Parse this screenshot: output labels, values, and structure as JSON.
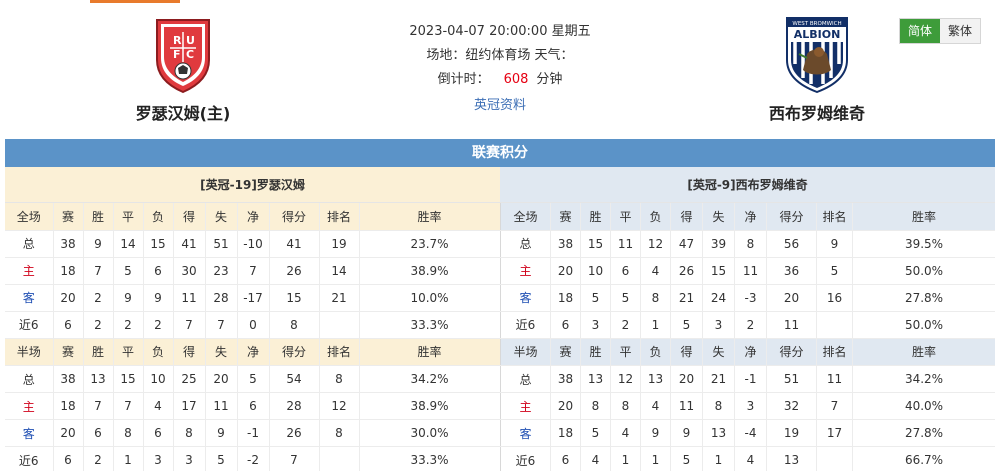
{
  "match": {
    "datetime": "2023-04-07 20:00:00 星期五",
    "venue": "场地：纽约体育场 天气：",
    "countdown_label": "倒计时：",
    "countdown_value": "608",
    "countdown_unit": "分钟",
    "league_link": "英冠资料"
  },
  "home_team": {
    "name": "罗瑟汉姆(主)",
    "logo": "rotherham-crest-icon"
  },
  "away_team": {
    "name": "西布罗姆维奇",
    "logo": "west-brom-albion-crest-icon"
  },
  "lang": {
    "simplified": "简体",
    "traditional": "繁体"
  },
  "section_title": "联赛积分",
  "colors": {
    "title_bar": "#5b93c8",
    "home_panel": "#fbf0d6",
    "away_panel": "#e0e8f1",
    "active_lang": "#3e9c3a",
    "home_label": "#d0021b",
    "away_label": "#1f4fb3",
    "countdown": "#e60012"
  },
  "left_panel": {
    "caption": "[英冠-19]罗瑟汉姆",
    "full": {
      "headers": [
        "全场",
        "赛",
        "胜",
        "平",
        "负",
        "得",
        "失",
        "净",
        "得分",
        "排名",
        "胜率"
      ],
      "rows": [
        [
          "总",
          "38",
          "9",
          "14",
          "15",
          "41",
          "51",
          "-10",
          "41",
          "19",
          "23.7%"
        ],
        [
          "主",
          "18",
          "7",
          "5",
          "6",
          "30",
          "23",
          "7",
          "26",
          "14",
          "38.9%"
        ],
        [
          "客",
          "20",
          "2",
          "9",
          "9",
          "11",
          "28",
          "-17",
          "15",
          "21",
          "10.0%"
        ],
        [
          "近6",
          "6",
          "2",
          "2",
          "2",
          "7",
          "7",
          "0",
          "8",
          "",
          "33.3%"
        ]
      ]
    },
    "half": {
      "headers": [
        "半场",
        "赛",
        "胜",
        "平",
        "负",
        "得",
        "失",
        "净",
        "得分",
        "排名",
        "胜率"
      ],
      "rows": [
        [
          "总",
          "38",
          "13",
          "15",
          "10",
          "25",
          "20",
          "5",
          "54",
          "8",
          "34.2%"
        ],
        [
          "主",
          "18",
          "7",
          "7",
          "4",
          "17",
          "11",
          "6",
          "28",
          "12",
          "38.9%"
        ],
        [
          "客",
          "20",
          "6",
          "8",
          "6",
          "8",
          "9",
          "-1",
          "26",
          "8",
          "30.0%"
        ],
        [
          "近6",
          "6",
          "2",
          "1",
          "3",
          "3",
          "5",
          "-2",
          "7",
          "",
          "33.3%"
        ]
      ]
    }
  },
  "right_panel": {
    "caption": "[英冠-9]西布罗姆维奇",
    "full": {
      "headers": [
        "全场",
        "赛",
        "胜",
        "平",
        "负",
        "得",
        "失",
        "净",
        "得分",
        "排名",
        "胜率"
      ],
      "rows": [
        [
          "总",
          "38",
          "15",
          "11",
          "12",
          "47",
          "39",
          "8",
          "56",
          "9",
          "39.5%"
        ],
        [
          "主",
          "20",
          "10",
          "6",
          "4",
          "26",
          "15",
          "11",
          "36",
          "5",
          "50.0%"
        ],
        [
          "客",
          "18",
          "5",
          "5",
          "8",
          "21",
          "24",
          "-3",
          "20",
          "16",
          "27.8%"
        ],
        [
          "近6",
          "6",
          "3",
          "2",
          "1",
          "5",
          "3",
          "2",
          "11",
          "",
          "50.0%"
        ]
      ]
    },
    "half": {
      "headers": [
        "半场",
        "赛",
        "胜",
        "平",
        "负",
        "得",
        "失",
        "净",
        "得分",
        "排名",
        "胜率"
      ],
      "rows": [
        [
          "总",
          "38",
          "13",
          "12",
          "13",
          "20",
          "21",
          "-1",
          "51",
          "11",
          "34.2%"
        ],
        [
          "主",
          "20",
          "8",
          "8",
          "4",
          "11",
          "8",
          "3",
          "32",
          "7",
          "40.0%"
        ],
        [
          "客",
          "18",
          "5",
          "4",
          "9",
          "9",
          "13",
          "-4",
          "19",
          "17",
          "27.8%"
        ],
        [
          "近6",
          "6",
          "4",
          "1",
          "1",
          "5",
          "1",
          "4",
          "13",
          "",
          "66.7%"
        ]
      ]
    }
  }
}
